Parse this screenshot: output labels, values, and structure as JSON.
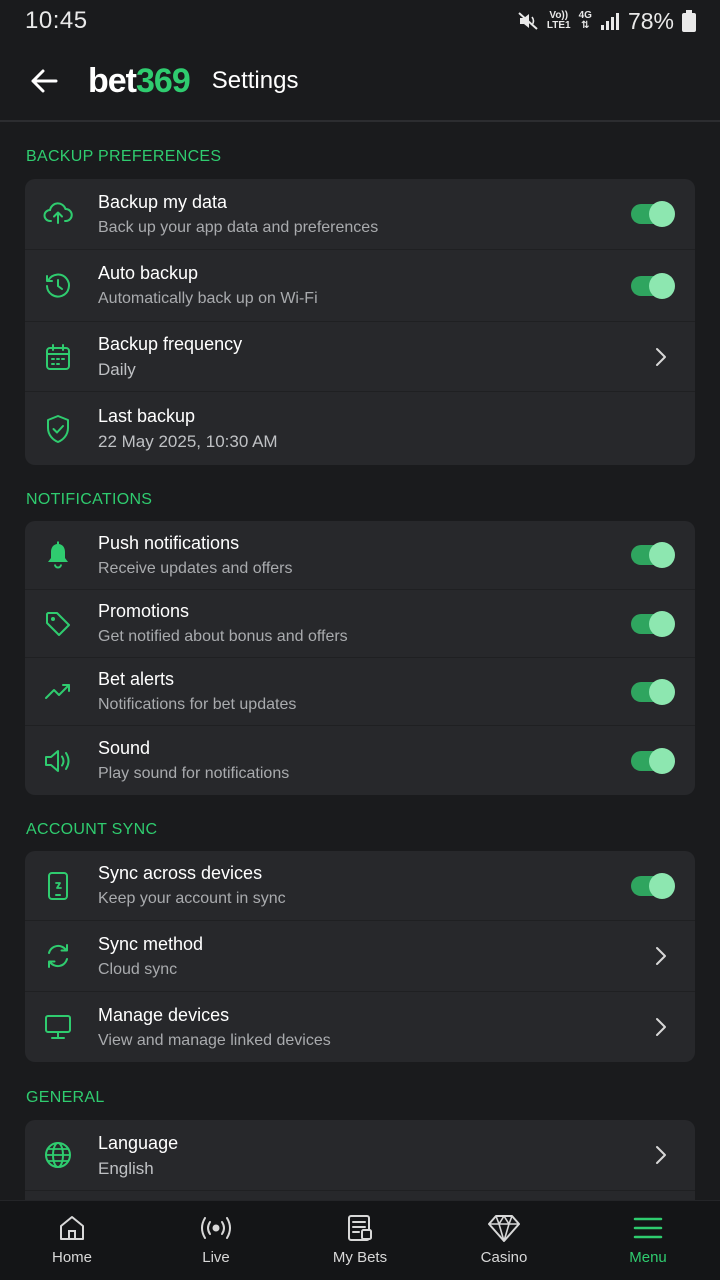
{
  "status": {
    "time": "10:45",
    "volte": "Vo))",
    "lte": "LTE1",
    "net": "4G",
    "battery": "78%"
  },
  "header": {
    "logo_bet": "bet",
    "logo_num": "369",
    "title": "Settings"
  },
  "sections": [
    {
      "title": "BACKUP PREFERENCES",
      "items": [
        {
          "title": "Backup my data",
          "subtitle": "Back up your app data and preferences",
          "control": "toggle",
          "on": true
        },
        {
          "title": "Auto backup",
          "subtitle": "Automatically back up on Wi-Fi",
          "control": "toggle",
          "on": true
        },
        {
          "title": "Backup frequency",
          "subtitle": "Daily",
          "control": "chevron"
        },
        {
          "title": "Last backup",
          "subtitle": "22 May 2025, 10:30 AM",
          "control": "none"
        }
      ]
    },
    {
      "title": "NOTIFICATIONS",
      "items": [
        {
          "title": "Push notifications",
          "subtitle": "Receive updates and offers",
          "control": "toggle",
          "on": true
        },
        {
          "title": "Promotions",
          "subtitle": "Get notified about bonus and offers",
          "control": "toggle",
          "on": true
        },
        {
          "title": "Bet alerts",
          "subtitle": "Notifications for bet updates",
          "control": "toggle",
          "on": true
        },
        {
          "title": "Sound",
          "subtitle": "Play sound for notifications",
          "control": "toggle",
          "on": true
        }
      ]
    },
    {
      "title": "ACCOUNT SYNC",
      "items": [
        {
          "title": "Sync across devices",
          "subtitle": "Keep your account in sync",
          "control": "toggle",
          "on": true
        },
        {
          "title": "Sync method",
          "subtitle": "Cloud sync",
          "control": "chevron"
        },
        {
          "title": "Manage devices",
          "subtitle": "View and manage linked devices",
          "control": "chevron"
        }
      ]
    },
    {
      "title": "GENERAL",
      "items": [
        {
          "title": "Language",
          "subtitle": "English",
          "control": "chevron"
        }
      ]
    }
  ],
  "nav": [
    {
      "label": "Home",
      "icon": "home-icon",
      "active": false
    },
    {
      "label": "Live",
      "icon": "live-icon",
      "active": false
    },
    {
      "label": "My Bets",
      "icon": "my-bets-icon",
      "active": false
    },
    {
      "label": "Casino",
      "icon": "casino-icon",
      "active": false
    },
    {
      "label": "Menu",
      "icon": "menu-icon",
      "active": true
    }
  ],
  "colors": {
    "accent": "#2fcc6f",
    "background": "#1a1b1d",
    "card": "#27282b"
  }
}
